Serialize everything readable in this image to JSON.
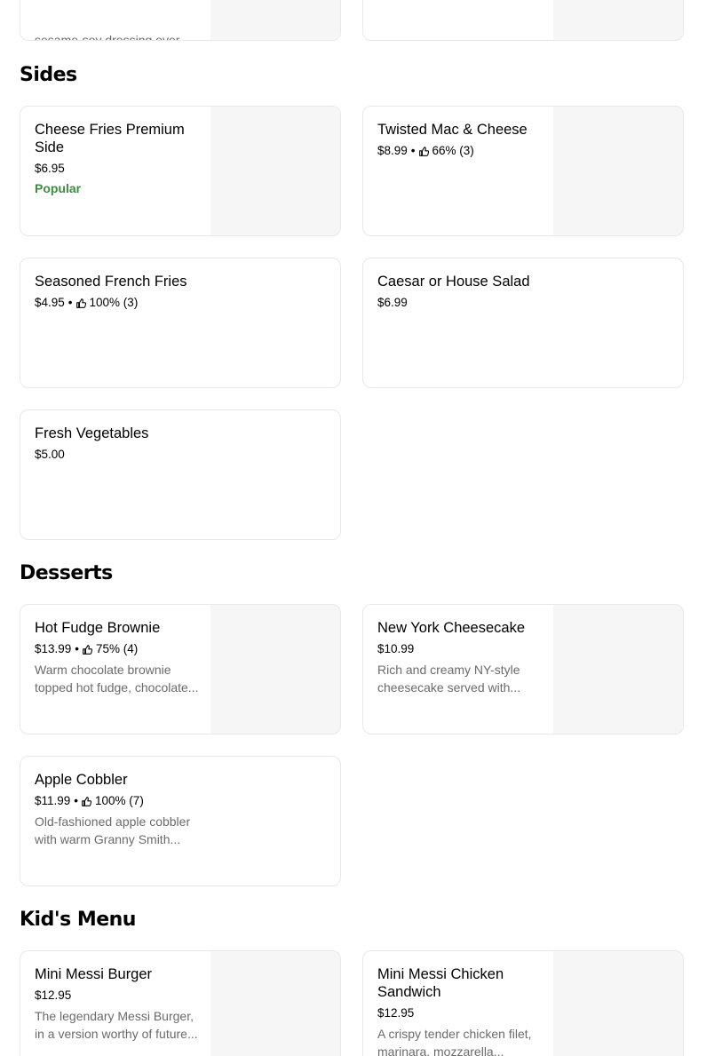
{
  "top_cards": [
    {
      "desc": "sesame-soy dressing over ..."
    },
    {
      "desc": ""
    }
  ],
  "sections": {
    "sides": {
      "title": "Sides",
      "items": [
        {
          "name": "Cheese Fries Premium Side",
          "price": "$6.95",
          "badge": "Popular"
        },
        {
          "name": "Twisted Mac & Cheese",
          "price": "$8.99",
          "rating": "66% (3)"
        },
        {
          "name": "Seasoned French Fries",
          "price": "$4.95",
          "rating": "100% (3)"
        },
        {
          "name": "Caesar or House Salad",
          "price": "$6.99"
        },
        {
          "name": "Fresh Vegetables",
          "price": "$5.00"
        }
      ]
    },
    "desserts": {
      "title": "Desserts",
      "items": [
        {
          "name": "Hot Fudge Brownie",
          "price": "$13.99",
          "rating": "75% (4)",
          "desc": "Warm chocolate brownie topped hot fudge, chocolate..."
        },
        {
          "name": "New York Cheesecake",
          "price": "$10.99",
          "desc": "Rich and creamy NY-style cheesecake served with..."
        },
        {
          "name": "Apple Cobbler",
          "price": "$11.99",
          "rating": "100% (7)",
          "desc": "Old-fashioned apple cobbler with warm Granny Smith..."
        }
      ]
    },
    "kids": {
      "title": "Kid's Menu",
      "items": [
        {
          "name": "Mini Messi Burger",
          "price": "$12.95",
          "desc": "The legendary Messi Burger, in a version worthy of future..."
        },
        {
          "name": "Mini Messi Chicken Sandwich",
          "price": "$12.95",
          "desc": "A crispy tender chicken filet, marinara, mozzarella..."
        }
      ]
    }
  },
  "rating_separator": "•",
  "icons": {
    "rating": "thumbs-up-icon"
  }
}
